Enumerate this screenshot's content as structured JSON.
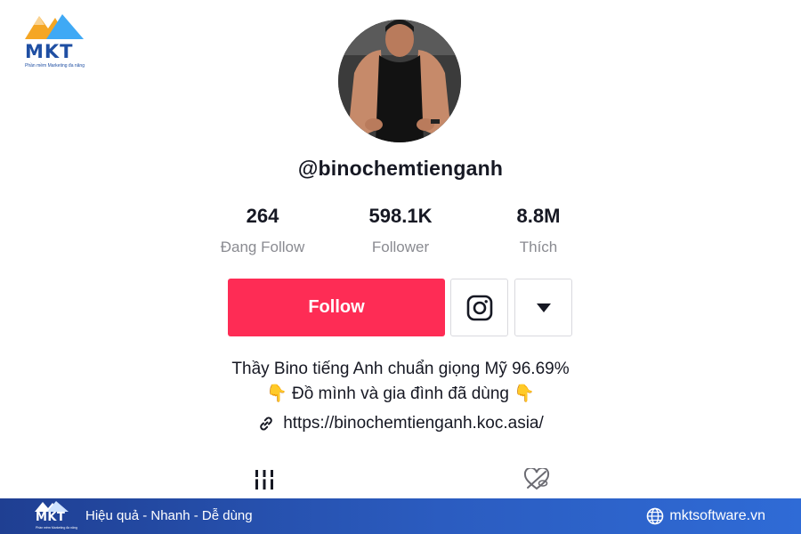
{
  "brand": {
    "logo_text": "MKT",
    "logo_tagline": "Phần mềm Marketing đa năng"
  },
  "profile": {
    "username": "@binochemtienganh",
    "stats": [
      {
        "value": "264",
        "label": "Đang Follow"
      },
      {
        "value": "598.1K",
        "label": "Follower"
      },
      {
        "value": "8.8M",
        "label": "Thích"
      }
    ],
    "follow_label": "Follow",
    "bio_line1": "Thầy Bino tiếng Anh chuẩn giọng Mỹ 96.69%",
    "bio_line2": "Đồ mình và gia đình đã dùng",
    "bio_emoji": "👇",
    "link": "https://binochemtienganh.koc.asia/",
    "accent_color": "#fe2c55"
  },
  "icons": {
    "instagram": "instagram-icon",
    "dropdown": "caret-down-icon",
    "link": "link-icon",
    "videos_tab": "grid-bars-icon",
    "liked_tab": "heart-hidden-icon",
    "globe": "globe-icon"
  },
  "footer": {
    "logo_text": "MKT",
    "logo_tagline": "Phần mềm Marketing đa năng",
    "slogan": "Hiệu quả - Nhanh - Dễ dùng",
    "website": "mktsoftware.vn",
    "bar_color": "#2b5cc0"
  }
}
